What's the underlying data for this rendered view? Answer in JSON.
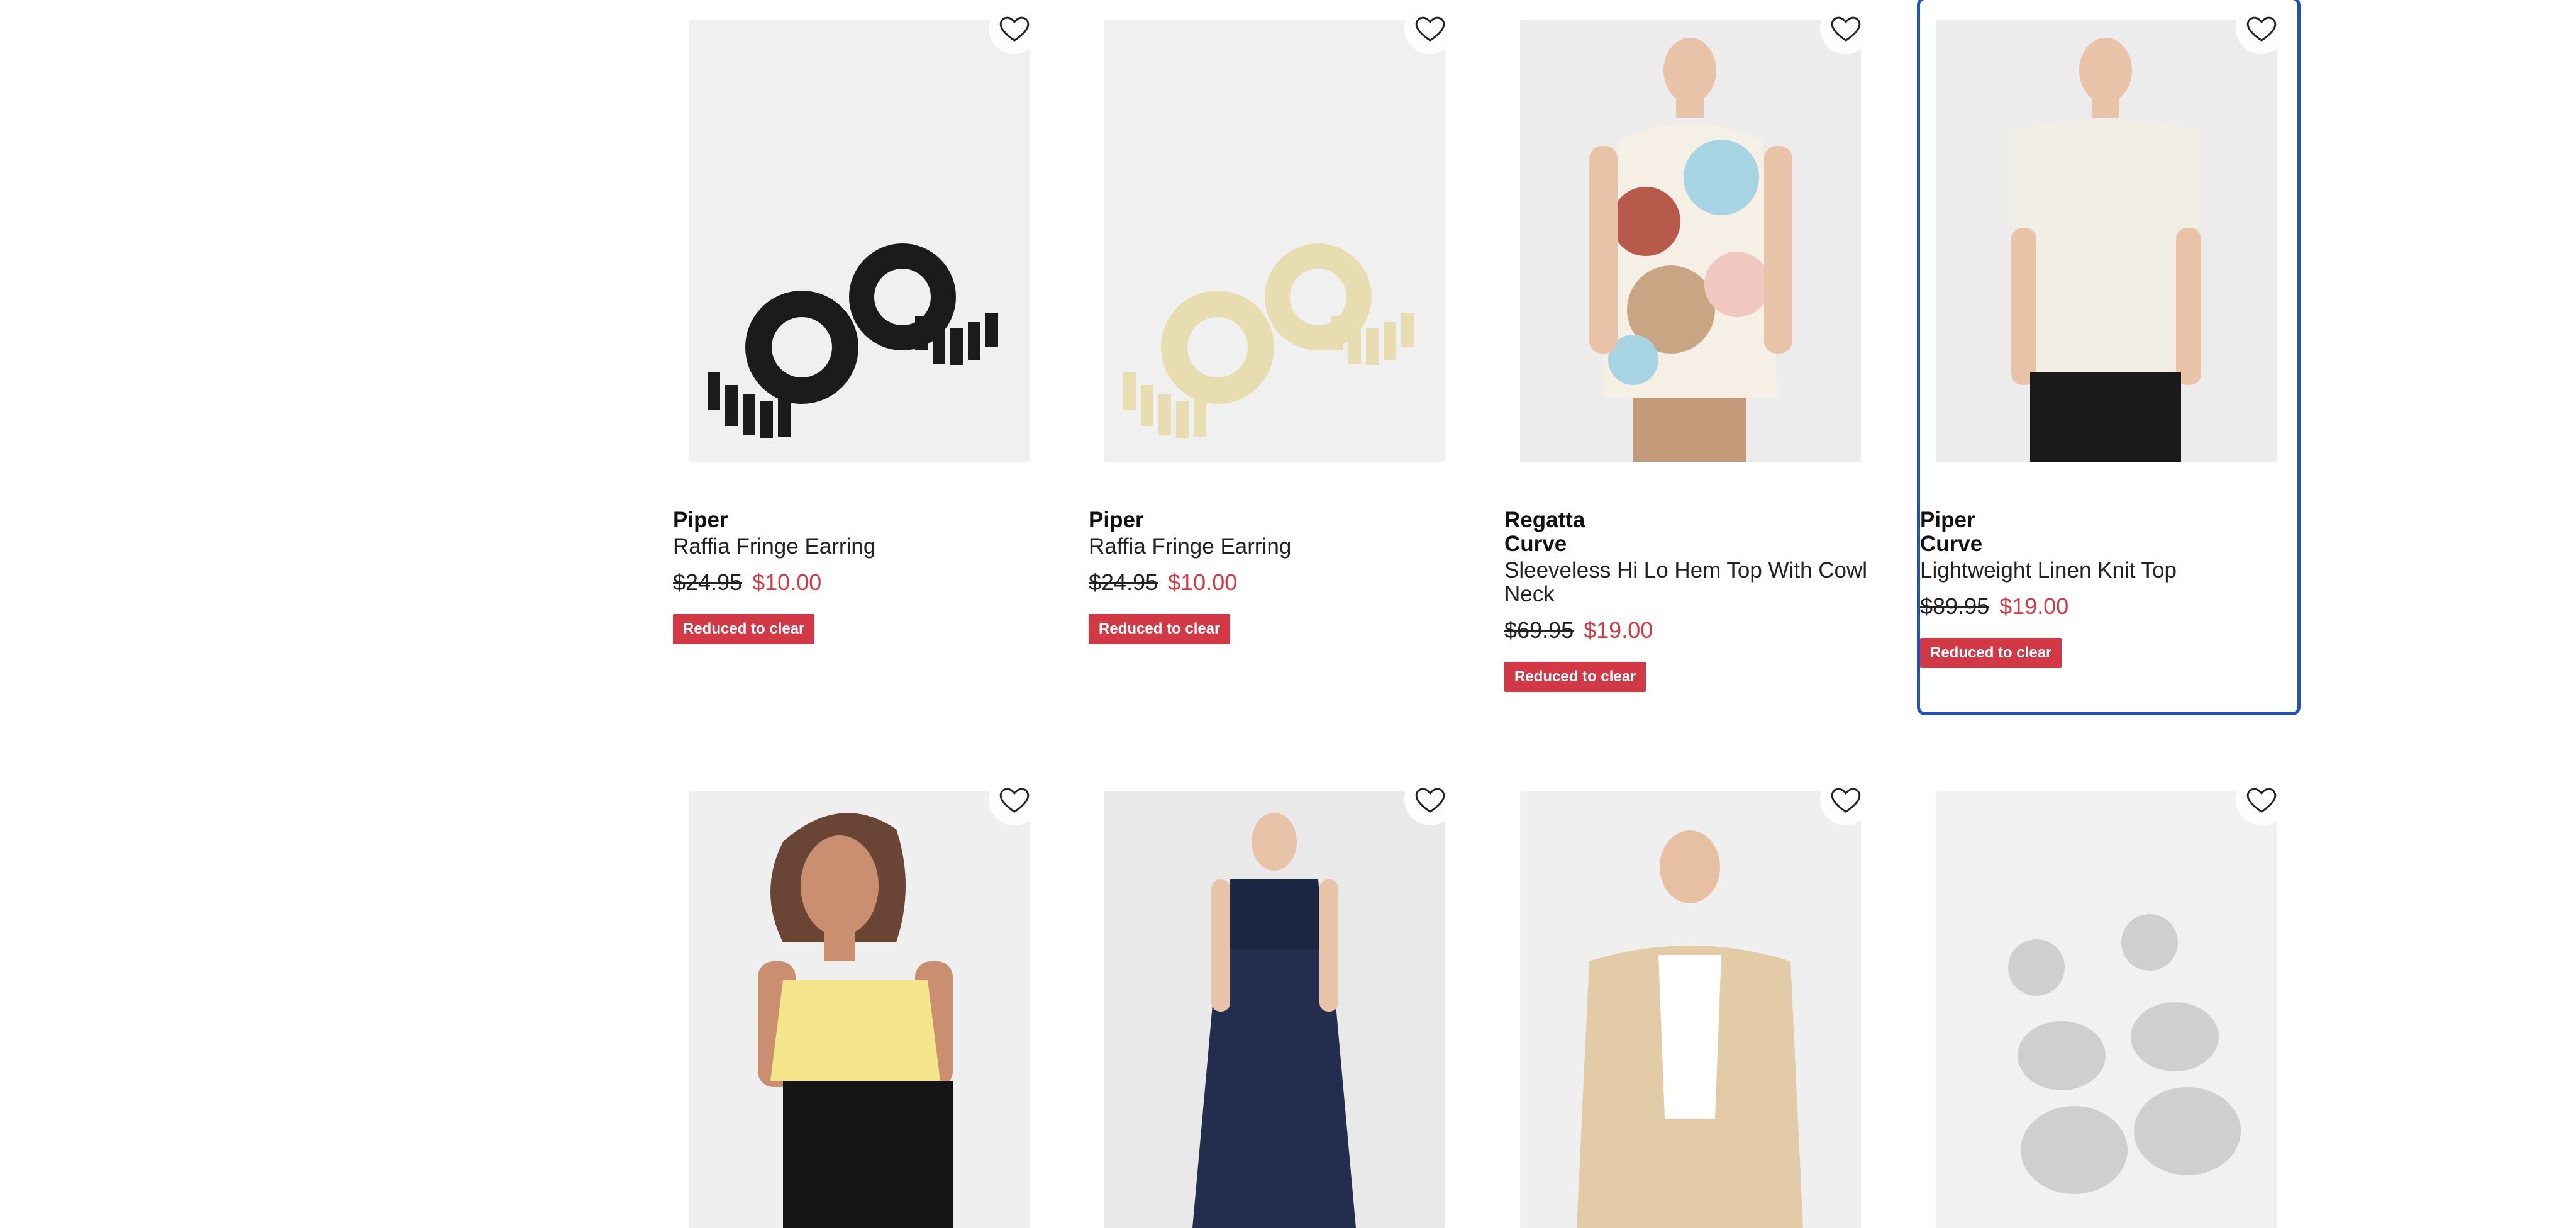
{
  "products": [
    {
      "brand": "Piper",
      "name": "Raffia Fringe Earring",
      "was": "$24.95",
      "now": "$10.00",
      "badge": "Reduced to clear",
      "image": "black-raffia-earrings"
    },
    {
      "brand": "Piper",
      "name": "Raffia Fringe Earring",
      "was": "$24.95",
      "now": "$10.00",
      "badge": "Reduced to clear",
      "image": "natural-raffia-earrings"
    },
    {
      "brand": "Regatta Curve",
      "name": "Sleeveless Hi Lo Hem Top With Cowl Neck",
      "was": "$69.95",
      "now": "$19.00",
      "badge": "Reduced to clear",
      "image": "printed-cowl-neck-top"
    },
    {
      "brand": "Piper Curve",
      "name": "Lightweight Linen Knit Top",
      "was": "$89.95",
      "now": "$19.00",
      "badge": "Reduced to clear",
      "image": "linen-knit-top"
    },
    {
      "image": "yellow-cami-top"
    },
    {
      "image": "navy-halter-maxi-dress"
    },
    {
      "image": "beige-blazer"
    },
    {
      "image": "silver-drop-earrings"
    }
  ],
  "colors": {
    "sale_price": "#d93843",
    "badge_bg": "#d23845",
    "focus_outline": "#1d52c7"
  },
  "icons": {
    "wishlist": "heart-outline-icon"
  }
}
